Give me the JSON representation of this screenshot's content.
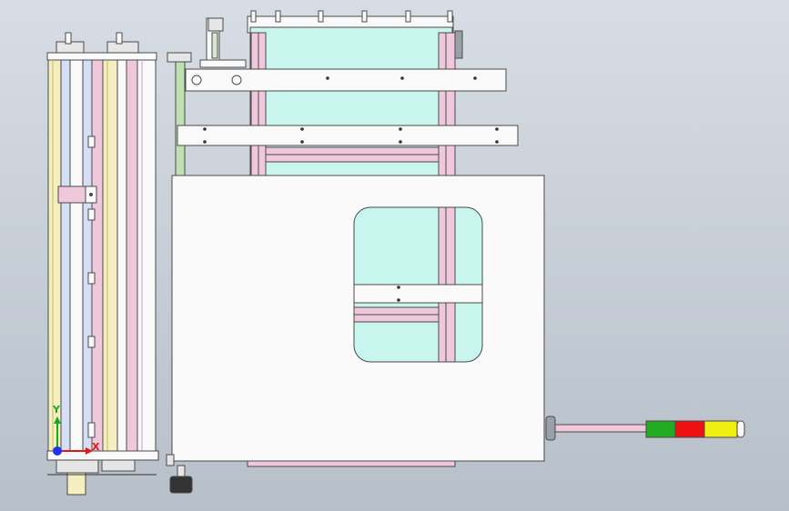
{
  "viewport": {
    "background_top": "#d7dde4",
    "background_bottom": "#b7bfc9"
  },
  "model": {
    "outline_color": "#4a4a4a",
    "white_part": "#fafafa",
    "cyan_panel": "#c8f5ee",
    "pink_part": "#f0c8dc",
    "roller_yellow": "#f4eec0",
    "roller_blue": "#d4def4",
    "olive_part": "#bfe0b0"
  },
  "signal_tower": {
    "stack_colors": [
      "#22aa22",
      "#ee1111",
      "#eeee11"
    ]
  },
  "triad": {
    "x_label": "X",
    "y_label": "Y",
    "x_color": "#e21818",
    "y_color": "#1aa81a",
    "z_color": "#2233ee"
  }
}
